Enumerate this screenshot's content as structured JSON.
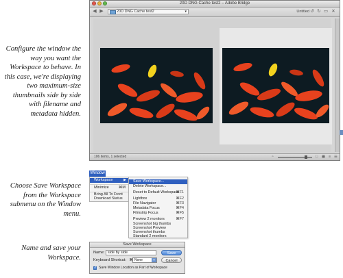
{
  "captions": {
    "window_setup": "Configure the window the way you want the Workspace to behave. In this case, we're displaying two maximum-size thumbnails side by side with filename and metadata hidden.",
    "menu_choice": "Choose Save Workspace from the Workspace submenu on the Window menu.",
    "save_step": "Name and save your Workspace."
  },
  "bridge": {
    "title": "20D DNG Cache test2 – Adobe Bridge",
    "path": "20D DNG Cache test2",
    "workspace_label": "Untitled",
    "status": "106 items, 1 selected",
    "zoom_fraction": 0.78
  },
  "window_menu": {
    "menubar_label": "Window",
    "items": [
      {
        "label": "Workspace"
      },
      {
        "label": "Minimize",
        "shortcut": "⌘M"
      },
      {
        "label": "Bring All To Front"
      },
      {
        "label": "Download Status"
      }
    ]
  },
  "workspace_submenu": {
    "items": [
      {
        "label": "Save Workspace...",
        "shortcut": ""
      },
      {
        "label": "Delete Workspace...",
        "shortcut": ""
      },
      {
        "label": "Reset to Default Workspace",
        "shortcut": "⌘F1"
      },
      {
        "label": "Lightbox",
        "shortcut": "⌘F2"
      },
      {
        "label": "File Navigator",
        "shortcut": "⌘F3"
      },
      {
        "label": "Metadata Focus",
        "shortcut": "⌘F4"
      },
      {
        "label": "Filmstrip Focus",
        "shortcut": "⌘F5"
      },
      {
        "label": "Preview 2 monitors",
        "shortcut": "⌘F7"
      },
      {
        "label": "Screenshot big thumbs",
        "shortcut": ""
      },
      {
        "label": "Screenshot Preview",
        "shortcut": ""
      },
      {
        "label": "Screenshot thumbs",
        "shortcut": ""
      },
      {
        "label": "Standard 2 monitors",
        "shortcut": ""
      }
    ]
  },
  "save_dialog": {
    "title": "Save Workspace",
    "name_label": "Name:",
    "name_value": "side by side",
    "shortcut_label": "Keyboard Shortcut:",
    "shortcut_key_prefix": "⌘+",
    "shortcut_value": "None",
    "save_button": "Save",
    "cancel_button": "Cancel",
    "checkbox_label": "Save Window Location as Part of Workspace",
    "checkbox_checked": true
  },
  "colors": {
    "highlight": "#2f5fbf",
    "fish_orange": "#e8421e",
    "fish_yellow": "#f2d21e",
    "water": "#0d1b22"
  }
}
